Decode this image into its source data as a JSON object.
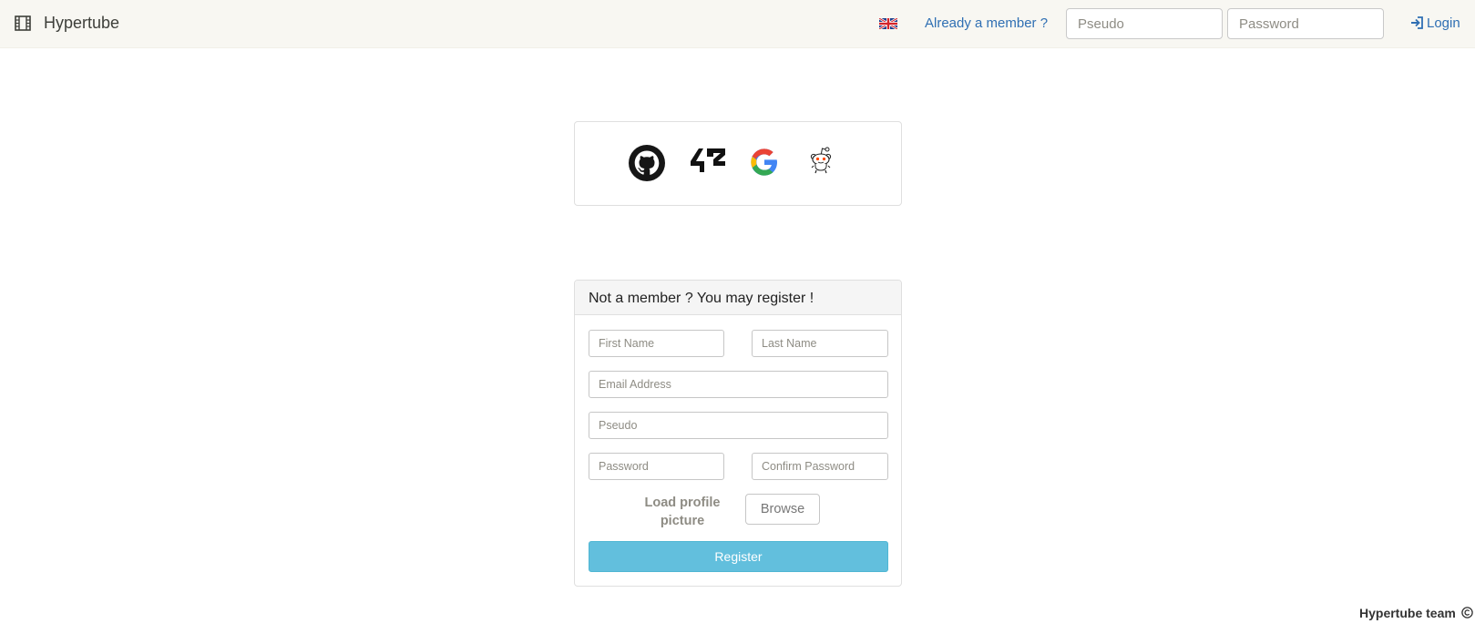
{
  "navbar": {
    "brand": "Hypertube",
    "already_member": "Already a member ?",
    "pseudo_placeholder": "Pseudo",
    "password_placeholder": "Password",
    "login_label": "Login"
  },
  "oauth": {
    "providers": [
      "github-icon",
      "42-logo",
      "google-icon",
      "reddit-icon"
    ],
    "logo_42_text": "42"
  },
  "register": {
    "title": "Not a member ? You may register !",
    "first_name_placeholder": "First Name",
    "last_name_placeholder": "Last Name",
    "email_placeholder": "Email Address",
    "pseudo_placeholder": "Pseudo",
    "password_placeholder": "Password",
    "confirm_password_placeholder": "Confirm Password",
    "load_picture_label": "Load profile picture",
    "browse_label": "Browse",
    "register_label": "Register"
  },
  "footer": {
    "text": "Hypertube team"
  },
  "colors": {
    "navbar_bg": "#f8f7f2",
    "link": "#2f6fb3",
    "register_button": "#62bfdd"
  }
}
